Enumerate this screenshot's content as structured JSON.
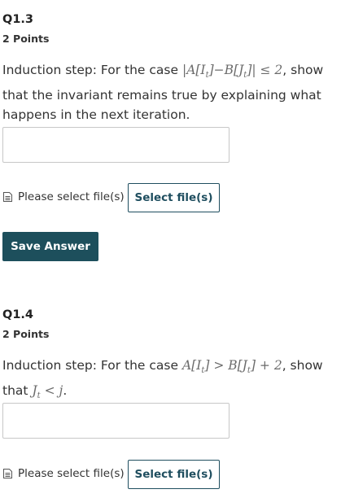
{
  "questions": [
    {
      "title": "Q1.3",
      "points": "2 Points",
      "prompt_before": "Induction step: For the case ",
      "math_a": "A[I",
      "math_a_sub": "t",
      "math_b": "]−B[J",
      "math_b_sub": "t",
      "math_c": "]| ≤ 2",
      "prompt_after": ", show that the invariant remains true by explaining what happens in the next iteration.",
      "file_label": "Please select file(s)",
      "select_label": "Select file(s)"
    },
    {
      "title": "Q1.4",
      "points": "2 Points",
      "prompt_before": "Induction step: For the case ",
      "math_a": "A[I",
      "math_a_sub": "t",
      "math_b": "] > B[J",
      "math_b_sub": "t",
      "math_c": "] + 2",
      "prompt_mid": ", show that ",
      "math_d": "J",
      "math_d_sub": "t",
      "math_e": " < j",
      "prompt_after": ".",
      "file_label": "Please select file(s)",
      "select_label": "Select file(s)"
    }
  ],
  "save_label": "Save Answer",
  "icons": {
    "file": "file-document-icon"
  }
}
